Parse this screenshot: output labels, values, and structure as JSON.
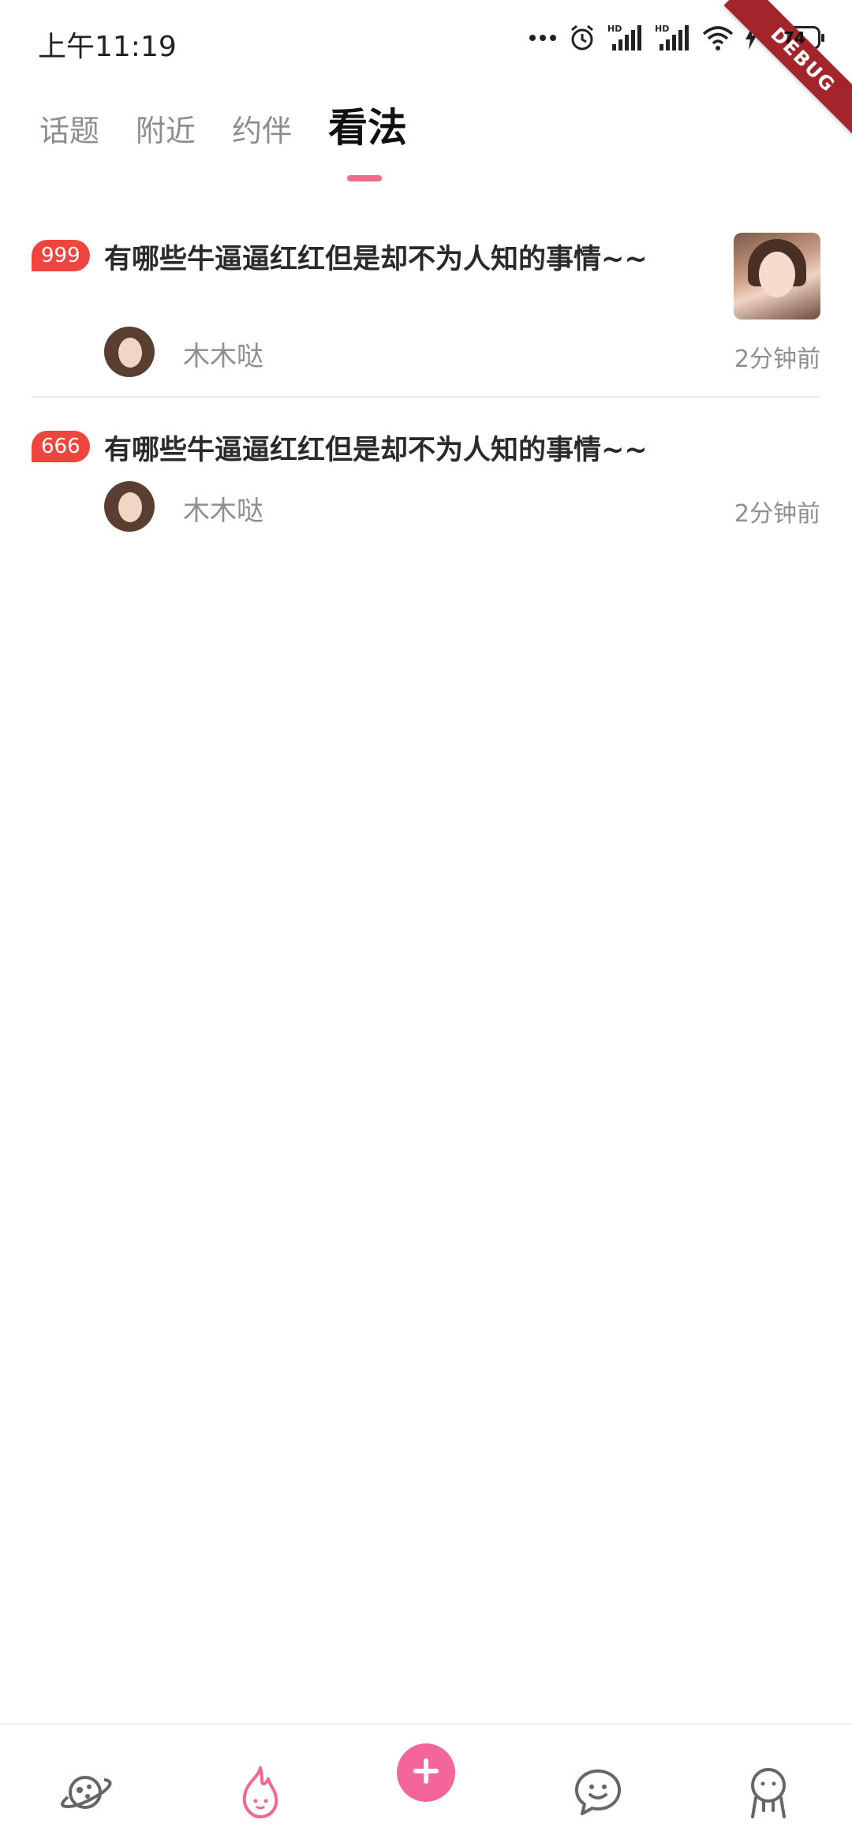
{
  "status_bar": {
    "time": "上午11:19",
    "battery_level": "74",
    "icons": [
      "more-dots-icon",
      "alarm-icon",
      "signal-hd-icon",
      "signal-hd-icon",
      "wifi-icon",
      "charging-icon",
      "battery-icon"
    ]
  },
  "debug_ribbon": {
    "label": "DEBUG"
  },
  "tabs": [
    {
      "label": "话题",
      "active": false
    },
    {
      "label": "附近",
      "active": false
    },
    {
      "label": "约伴",
      "active": false
    },
    {
      "label": "看法",
      "active": true
    }
  ],
  "feed": [
    {
      "count": "999",
      "title": "有哪些牛逼逼红红但是却不为人知的事情~~",
      "author": "木木哒",
      "time": "2分钟前",
      "has_thumbnail": true
    },
    {
      "count": "666",
      "title": "有哪些牛逼逼红红但是却不为人知的事情~~",
      "author": "木木哒",
      "time": "2分钟前",
      "has_thumbnail": false
    }
  ],
  "bottom_nav": [
    {
      "icon": "planet-icon"
    },
    {
      "icon": "flame-icon",
      "active": true
    },
    {
      "icon": "plus-icon"
    },
    {
      "icon": "chat-icon"
    },
    {
      "icon": "profile-icon"
    }
  ],
  "colors": {
    "accent_pink": "#f06b8a",
    "badge_red": "#f0453e",
    "plus_button": "#f4669a",
    "muted_text": "#8f8f8f"
  }
}
